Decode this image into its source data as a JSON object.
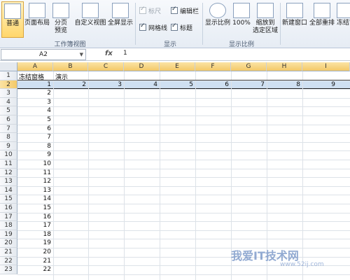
{
  "ribbon": {
    "buttons": [
      {
        "label": "普通",
        "active": true
      },
      {
        "label": "页面布局"
      },
      {
        "label": "分页\n预览"
      },
      {
        "label": "自定义视图"
      },
      {
        "label": "全屏显示"
      },
      {
        "label": "显示比例"
      },
      {
        "label": "100%"
      },
      {
        "label": "缩放到\n选定区域"
      },
      {
        "label": "新建窗口"
      },
      {
        "label": "全部重排"
      },
      {
        "label": "冻结窗"
      }
    ],
    "checkboxes": [
      {
        "label": "标尺",
        "checked": true,
        "disabled": true
      },
      {
        "label": "编辑栏",
        "checked": true
      },
      {
        "label": "网格线",
        "checked": true
      },
      {
        "label": "标题",
        "checked": true
      }
    ],
    "groups": {
      "workbook_views": "工作簿视图",
      "show": "显示",
      "zoom": "显示比例"
    }
  },
  "formula_bar": {
    "name_box": "A2",
    "fx": "fx",
    "value": "1"
  },
  "columns": [
    "A",
    "B",
    "C",
    "D",
    "E",
    "F",
    "G",
    "H",
    "I"
  ],
  "rows": [
    "1",
    "2",
    "3",
    "4",
    "5",
    "6",
    "7",
    "8",
    "9",
    "10",
    "11",
    "12",
    "13",
    "14",
    "15",
    "16",
    "17",
    "18",
    "19",
    "20",
    "21",
    "22",
    "23"
  ],
  "row1": {
    "a": "冻结窗格",
    "b": "演示"
  },
  "row2_values": [
    "1",
    "2",
    "3",
    "4",
    "5",
    "6",
    "7",
    "8",
    "9"
  ],
  "colA_values": [
    "2",
    "3",
    "4",
    "5",
    "6",
    "7",
    "8",
    "9",
    "10",
    "11",
    "12",
    "13",
    "14",
    "15",
    "16",
    "17",
    "18",
    "19",
    "20",
    "21",
    "22"
  ],
  "watermark": {
    "text": "我爱IT技术网",
    "url": "www.52ij.com"
  },
  "colors": {
    "selection": "#cfe0f2",
    "header_highlight": "#f3c969"
  }
}
